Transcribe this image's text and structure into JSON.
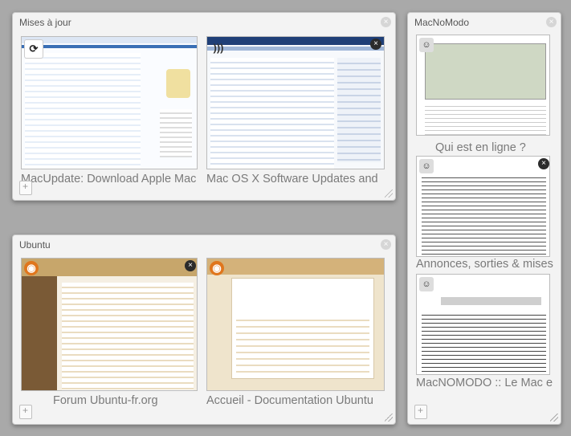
{
  "colors": {
    "macupdate": "#3a6fb5",
    "ubuntu": "#c7a66b",
    "macnomodo": "#333333"
  },
  "groups": [
    {
      "title": "Mises à jour",
      "tabs": [
        {
          "title": "MacUpdate: Download Apple Mac",
          "favicon": "refresh-icon"
        },
        {
          "title": "Mac OS X Software Updates and",
          "favicon": "wifi-icon"
        }
      ]
    },
    {
      "title": "Ubuntu",
      "tabs": [
        {
          "title": "Forum Ubuntu-fr.org",
          "favicon": "ubuntu-logo-icon"
        },
        {
          "title": "Accueil - Documentation Ubuntu",
          "favicon": "ubuntu-logo-icon"
        }
      ]
    },
    {
      "title": "MacNoModo",
      "tabs": [
        {
          "title": "Qui est en ligne ?",
          "favicon": "finder-icon"
        },
        {
          "title": "Annonces, sorties & mises",
          "favicon": "finder-icon"
        },
        {
          "title": "MacNOMODO :: Le Mac e",
          "favicon": "finder-icon"
        }
      ]
    }
  ],
  "close_glyph": "×"
}
